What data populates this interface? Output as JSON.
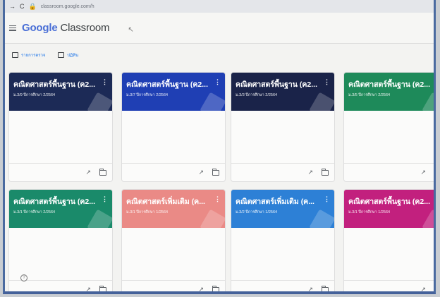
{
  "browser": {
    "url": "classroom.google.com/h"
  },
  "app": {
    "brand_google": "Google",
    "brand_product": "Classroom"
  },
  "subnav": {
    "todo_label": "รายการตรวจ",
    "calendar_label": "ปฏิทิน"
  },
  "colors": {
    "navy": "#1c2a56",
    "royal": "#1f3fb4",
    "green": "#1e8a5a",
    "teal": "#1a8a6a",
    "salmon": "#ea8a86",
    "sky": "#2d80d6",
    "magenta": "#c2207e"
  },
  "classes": [
    {
      "title": "คณิตศาสตร์พื้นฐาน (ค2...",
      "subtitle": "ม.3/9 ปีการศึกษา 2/2564",
      "color": "#1c2a56"
    },
    {
      "title": "คณิตศาสตร์พื้นฐาน (ค2...",
      "subtitle": "ม.3/7 ปีการศึกษา 2/2564",
      "color": "#1f3fb4"
    },
    {
      "title": "คณิตศาสตร์พื้นฐาน (ค2...",
      "subtitle": "ม.3/3 ปีการศึกษา 2/2564",
      "color": "#1a2349"
    },
    {
      "title": "คณิตศาสตร์พื้นฐาน (ค2...",
      "subtitle": "ม.3/5 ปีการศึกษา 2/2564",
      "color": "#1e8a5a"
    },
    {
      "title": "คณิตศาสตร์พื้นฐาน (ค2...",
      "subtitle": "ม.3/1 ปีการศึกษา 2/2564",
      "color": "#1a8a6a"
    },
    {
      "title": "คณิตศาสตร์เพิ่มเติม (ค...",
      "subtitle": "ม.3/1 ปีการศึกษา 1/2564",
      "color": "#ea8a86"
    },
    {
      "title": "คณิตศาสตร์เพิ่มเติม (ค...",
      "subtitle": "ม.3/2 ปีการศึกษา 1/2564",
      "color": "#2d80d6"
    },
    {
      "title": "คณิตศาสตร์พื้นฐาน (ค2...",
      "subtitle": "ม.3/1 ปีการศึกษา 1/2564",
      "color": "#c2207e"
    }
  ]
}
